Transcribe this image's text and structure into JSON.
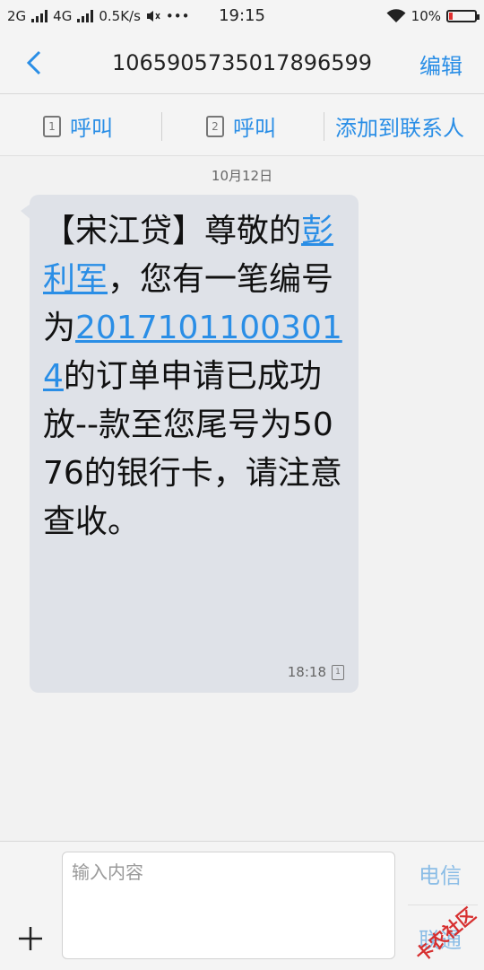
{
  "status": {
    "network1": "2G",
    "network2": "4G",
    "speed": "0.5K/s",
    "more": "•••",
    "time": "19:15",
    "battery": "10%"
  },
  "header": {
    "title": "1065905735017896599",
    "edit_label": "编辑"
  },
  "actions": {
    "call1_label": "呼叫",
    "call2_label": "呼叫",
    "add_contact_label": "添加到联系人",
    "sim1": "1",
    "sim2": "2"
  },
  "conversation": {
    "date": "10月12日",
    "message": {
      "part1": "【宋江贷】尊敬的",
      "name_link": "彭利军",
      "part2": "，您有一笔编号为",
      "number_link": "20171011003014",
      "part3": "的订单申请已成功放--款至您尾号为5076的银行卡，请注意查收。",
      "time": "18:18",
      "sim": "1"
    }
  },
  "composer": {
    "placeholder": "输入内容",
    "carrier_top": "电信",
    "carrier_bottom": "联通"
  },
  "watermark": "卡农社区"
}
